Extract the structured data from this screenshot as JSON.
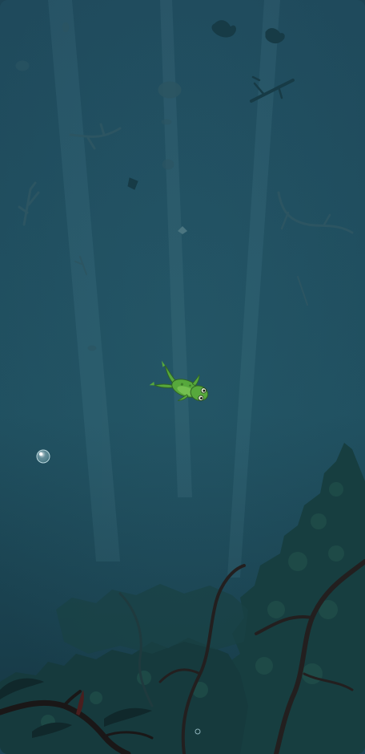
{
  "scene": {
    "water_top": "#1f4a5c",
    "water_mid": "#205060",
    "water_bottom": "#153642",
    "far_debris_color": "#2c5562",
    "near_debris_color": "#173b46",
    "foliage_color": "#173e40",
    "foliage_light": "#21504a",
    "branch_color": "#231f1f",
    "branch_dark": "#1a1717"
  },
  "player": {
    "kind": "frog",
    "body_color": "#57a83c",
    "belly_color": "#7cc455",
    "eye_color": "#d8e4c8"
  },
  "bubble": {
    "color": "#b9d6dc"
  }
}
